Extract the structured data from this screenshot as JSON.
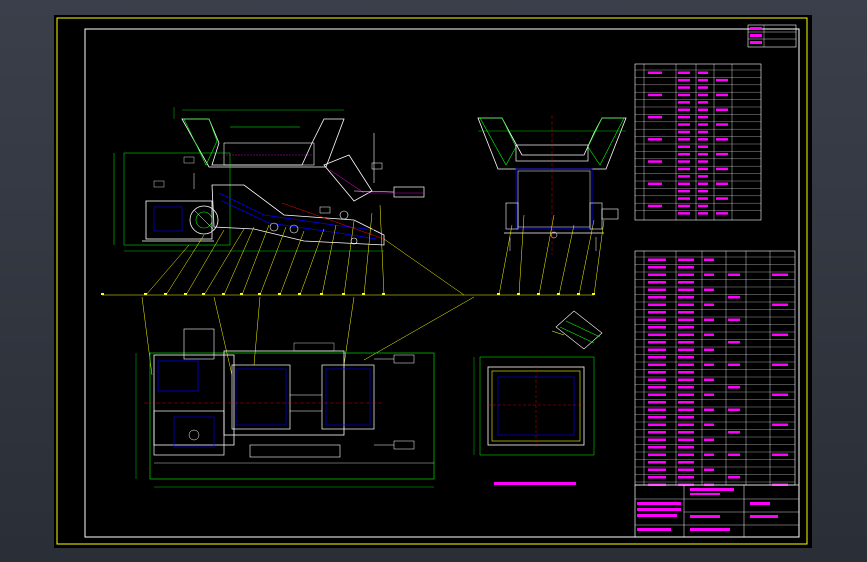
{
  "window": {
    "title": ""
  },
  "colors": {
    "background": "#000000",
    "frame": "#ffff00",
    "outline": "#00ff00",
    "body": "#ffffff",
    "hidden": "#0000ff",
    "center": "#ff0000",
    "text": "#ff00ff",
    "leader": "#ffff00"
  },
  "drawing": {
    "note_text": "",
    "title_block_text": ""
  }
}
